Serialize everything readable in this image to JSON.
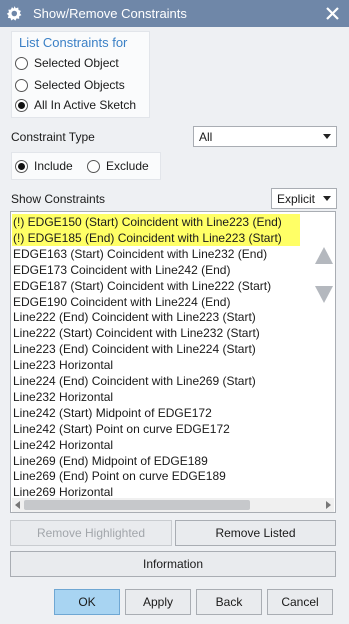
{
  "window": {
    "title": "Show/Remove Constraints"
  },
  "list_constraints": {
    "title": "List Constraints for",
    "options": [
      "Selected Object",
      "Selected Objects",
      "All In Active Sketch"
    ],
    "selected_index": 2
  },
  "constraint_type": {
    "label": "Constraint Type",
    "value": "All"
  },
  "include_exclude": {
    "include": "Include",
    "exclude": "Exclude",
    "selected": "Include"
  },
  "show_constraints": {
    "label": "Show Constraints",
    "value": "Explicit"
  },
  "constraints": [
    {
      "text": "(!) EDGE150 (Start) Coincident with Line223 (End)",
      "highlighted": true
    },
    {
      "text": "(!) EDGE185 (End) Coincident with Line223 (Start)",
      "highlighted": true
    },
    {
      "text": "EDGE163 (Start) Coincident with Line232 (End)",
      "highlighted": false
    },
    {
      "text": "EDGE173  Coincident with Line242 (End)",
      "highlighted": false
    },
    {
      "text": "EDGE187 (Start) Coincident with Line222 (Start)",
      "highlighted": false
    },
    {
      "text": "EDGE190  Coincident with Line224 (End)",
      "highlighted": false
    },
    {
      "text": "Line222 (End) Coincident with Line223 (Start)",
      "highlighted": false
    },
    {
      "text": "Line222 (Start) Coincident with Line232 (Start)",
      "highlighted": false
    },
    {
      "text": "Line223 (End) Coincident with Line224 (Start)",
      "highlighted": false
    },
    {
      "text": "Line223 Horizontal",
      "highlighted": false
    },
    {
      "text": "Line224 (End) Coincident with Line269 (Start)",
      "highlighted": false
    },
    {
      "text": "Line232 Horizontal",
      "highlighted": false
    },
    {
      "text": "Line242 (Start) Midpoint of EDGE172",
      "highlighted": false
    },
    {
      "text": "Line242 (Start) Point on curve EDGE172",
      "highlighted": false
    },
    {
      "text": "Line242 Horizontal",
      "highlighted": false
    },
    {
      "text": "Line269 (End) Midpoint of EDGE189",
      "highlighted": false
    },
    {
      "text": "Line269 (End) Point on curve EDGE189",
      "highlighted": false
    },
    {
      "text": "Line269 Horizontal",
      "highlighted": false
    }
  ],
  "buttons": {
    "remove_highlighted": "Remove Highlighted",
    "remove_listed": "Remove Listed",
    "information": "Information",
    "ok": "OK",
    "apply": "Apply",
    "back": "Back",
    "cancel": "Cancel"
  },
  "colors": {
    "titlebar": "#6f87a8",
    "highlight_row": "#ffff66",
    "group_title": "#3b80c6",
    "ok_button": "#a8d4f2"
  }
}
